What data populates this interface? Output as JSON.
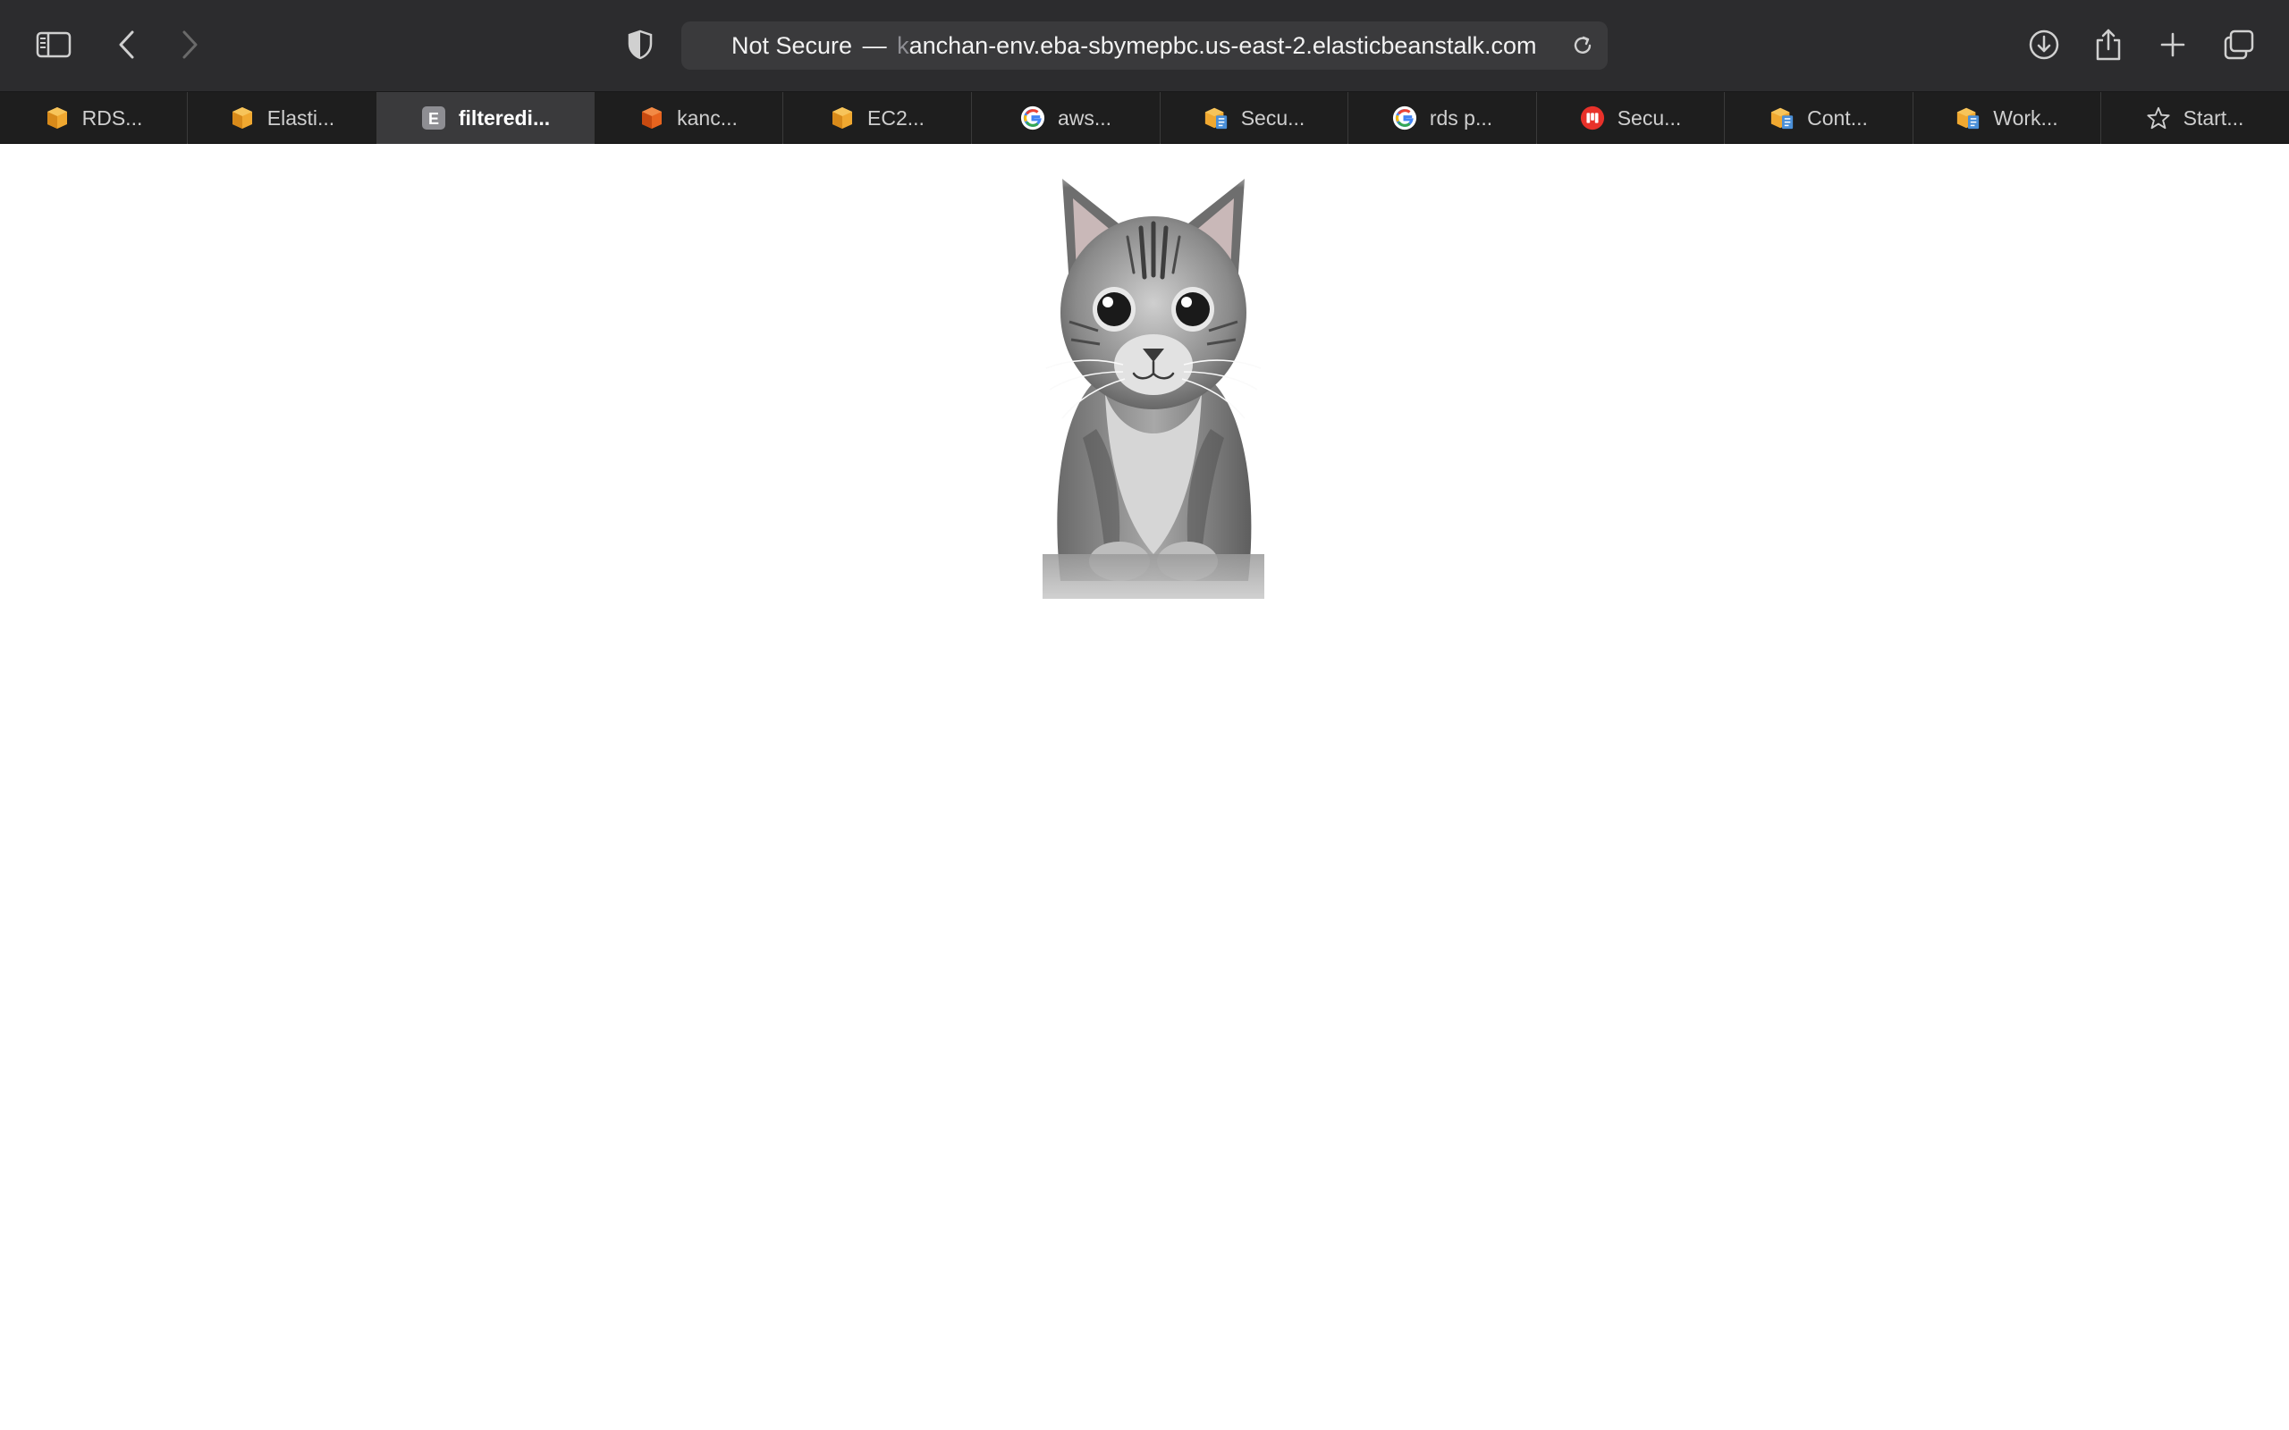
{
  "toolbar": {
    "icons": {
      "sidebar": "sidebar-icon",
      "back": "chevron-left-icon",
      "forward": "chevron-right-icon",
      "privacy": "shield-icon",
      "download": "download-icon",
      "share": "share-icon",
      "new_tab": "plus-icon",
      "tab_overview": "tabs-icon",
      "reload": "reload-icon"
    }
  },
  "address_bar": {
    "security_label": "Not Secure",
    "separator": "—",
    "obscured_prefix": "k",
    "url": "anchan-env.eba-sbymepbc.us-east-2.elasticbeanstalk.com"
  },
  "tabs": [
    {
      "label": "RDS...",
      "icon": "aws-cube-icon",
      "active": false
    },
    {
      "label": "Elasti...",
      "icon": "aws-cube-icon",
      "active": false
    },
    {
      "label": "filteredi...",
      "icon": "letter-e-icon",
      "active": true
    },
    {
      "label": "kanc...",
      "icon": "aws-orange-cube-icon",
      "active": false
    },
    {
      "label": "EC2...",
      "icon": "aws-cube-icon",
      "active": false
    },
    {
      "label": "aws...",
      "icon": "google-icon",
      "active": false
    },
    {
      "label": "Secu...",
      "icon": "aws-docs-icon",
      "active": false
    },
    {
      "label": "rds p...",
      "icon": "google-icon",
      "active": false
    },
    {
      "label": "Secu...",
      "icon": "red-circle-icon",
      "active": false
    },
    {
      "label": "Cont...",
      "icon": "aws-docs-icon",
      "active": false
    },
    {
      "label": "Work...",
      "icon": "aws-docs-icon",
      "active": false
    },
    {
      "label": "Start...",
      "icon": "star-icon",
      "active": false
    }
  ],
  "colors": {
    "toolbar_bg": "#2c2c2e",
    "tabbar_bg": "#1e1e1e",
    "active_tab_bg": "#3a3a3c",
    "page_bg": "#ffffff"
  },
  "page": {
    "image_subject": "grayscale-cat-photo"
  }
}
